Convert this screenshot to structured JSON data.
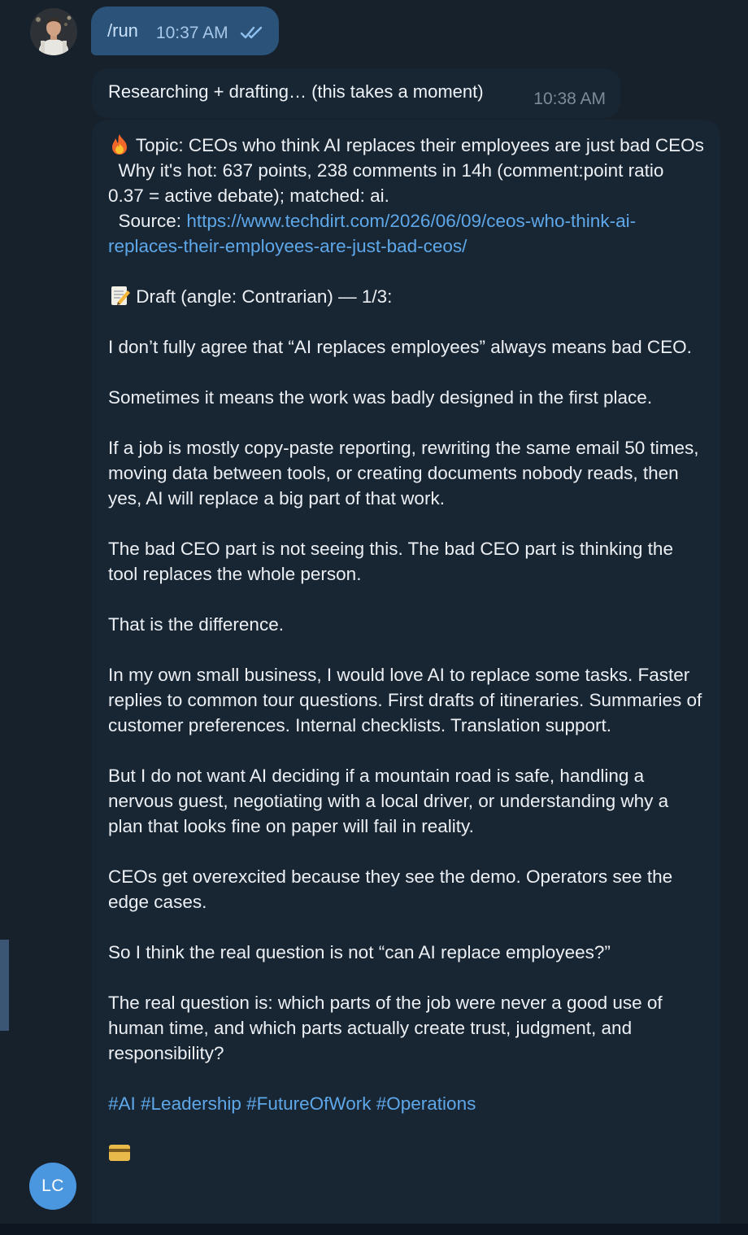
{
  "sent_message": {
    "text": "/run",
    "time": "10:37 AM",
    "status_icon": "double-check-icon"
  },
  "status_message": {
    "text": "Researching + drafting… (this takes a moment)",
    "time": "10:38 AM"
  },
  "bot_message": {
    "topic_icon": "fire-emoji",
    "topic_text": "Topic: CEOs who think AI replaces their employees are just bad CEOs",
    "why_hot": "  Why it's hot: 637 points, 238 comments in 14h (comment:point ratio 0.37 = active debate); matched: ai.",
    "source_label": "  Source: ",
    "source_url": "https://www.techdirt.com/2026/06/09/ceos-who-think-ai-replaces-their-employees-are-just-bad-ceos/",
    "draft_icon": "memo-emoji",
    "draft_header": "Draft (angle: Contrarian) — 1/3:",
    "paragraphs": [
      "I don’t fully agree that “AI replaces employees” always means bad CEO.",
      "Sometimes it means the work was badly designed in the first place.",
      "If a job is mostly copy-paste reporting, rewriting the same email 50 times, moving data between tools, or creating documents nobody reads, then yes, AI will replace a big part of that work.",
      "The bad CEO part is not seeing this. The bad CEO part is thinking the tool replaces the whole person.",
      "That is the difference.",
      "In my own small business, I would love AI to replace some tasks. Faster replies to common tour questions. First drafts of itineraries. Summaries of customer preferences. Internal checklists. Translation support.",
      "But I do not want AI deciding if a mountain road is safe, handling a nervous guest, negotiating with a local driver, or understanding why a plan that looks fine on paper will fail in reality.",
      "CEOs get overexcited because they see the demo. Operators see the edge cases.",
      "So I think the real question is not “can AI replace employees?”",
      "The real question is: which parts of the job were never a good use of human time, and which parts actually create trust, judgment, and responsibility?"
    ],
    "hashtags": "#AI #Leadership #FutureOfWork #Operations"
  },
  "avatars": {
    "user_photo": "user-photo-avatar",
    "bot_initials": "LC"
  },
  "colors": {
    "background": "#17212b",
    "outgoing_bubble": "#2b5278",
    "incoming_bubble": "#182533",
    "link": "#5ea8ea",
    "avatar_bg": "#4a97e0"
  }
}
